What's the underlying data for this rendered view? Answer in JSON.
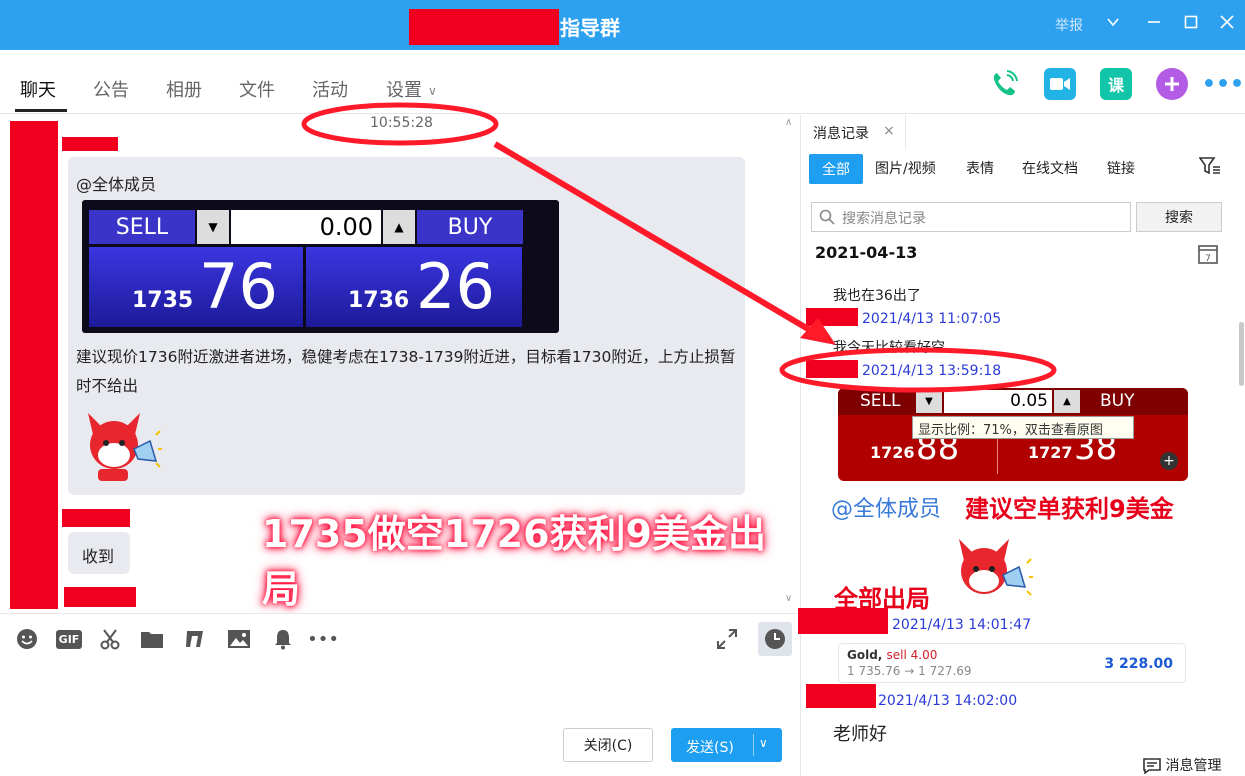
{
  "window": {
    "title": "指导群",
    "report_label": "举报",
    "controls": [
      "minimize-caret",
      "minimize",
      "maximize",
      "close"
    ]
  },
  "tabs": [
    {
      "label": "聊天"
    },
    {
      "label": "公告"
    },
    {
      "label": "相册"
    },
    {
      "label": "文件"
    },
    {
      "label": "活动"
    },
    {
      "label": "设置"
    }
  ],
  "top_actions": {
    "course_label": "课"
  },
  "chat": {
    "timestamp": "10:55:28",
    "mention": "@全体成员",
    "trade_widget": {
      "sell_label": "SELL",
      "buy_label": "BUY",
      "volume": "0.00",
      "sell_price_prefix": "1735",
      "sell_price_big": "76",
      "buy_price_prefix": "1736",
      "buy_price_big": "26"
    },
    "message_text": "建议现价1736附近激进者进场，稳健考虑在1738-1739附近进，目标看1730附近，上方止损暂时不给出",
    "reply_text": "收到",
    "callout": "1735做空1726获利9美金出局"
  },
  "toolbar": {
    "icons": [
      "emoji-icon",
      "gif-icon",
      "scissors-icon",
      "folder-icon",
      "music-icon",
      "image-icon",
      "bell-icon",
      "more-icon"
    ],
    "gif_label": "GIF",
    "close_label": "关闭(C)",
    "send_label": "发送(S)"
  },
  "history": {
    "tab_label": "消息记录",
    "filters": [
      "全部",
      "图片/视频",
      "表情",
      "在线文档",
      "链接"
    ],
    "search_placeholder": "搜索消息记录",
    "search_button": "搜索",
    "date": "2021-04-13",
    "items": {
      "msg1": "我也在36出了",
      "ts1": "2021/4/13 11:07:05",
      "msg2": "我今天比较看好空",
      "ts2": "2021/4/13 13:59:18",
      "ts3": "2021/4/13 14:01:47",
      "ts4": "2021/4/13 14:02:00",
      "msg3": "老师好"
    },
    "trade_image": {
      "sell_label": "SELL",
      "buy_label": "BUY",
      "volume": "0.05",
      "sell_prefix": "1726",
      "sell_big": "88",
      "buy_prefix": "1727",
      "buy_big": "38"
    },
    "tooltip": "显示比例：71%，双击查看原图",
    "mention": "@全体成员",
    "headline": "建议空单获利9美金",
    "all_out": "全部出局",
    "gold_card": {
      "symbol": "Gold",
      "side": "sell 4.00",
      "prices": "1 735.76 → 1 727.69",
      "amount": "3 228.00"
    },
    "manage_label": "消息管理"
  },
  "colors": {
    "titlebar": "#2ea0f0",
    "accent": "#1e9ef0",
    "redaction": "#f0001e",
    "annotation": "#ff1a2a"
  }
}
